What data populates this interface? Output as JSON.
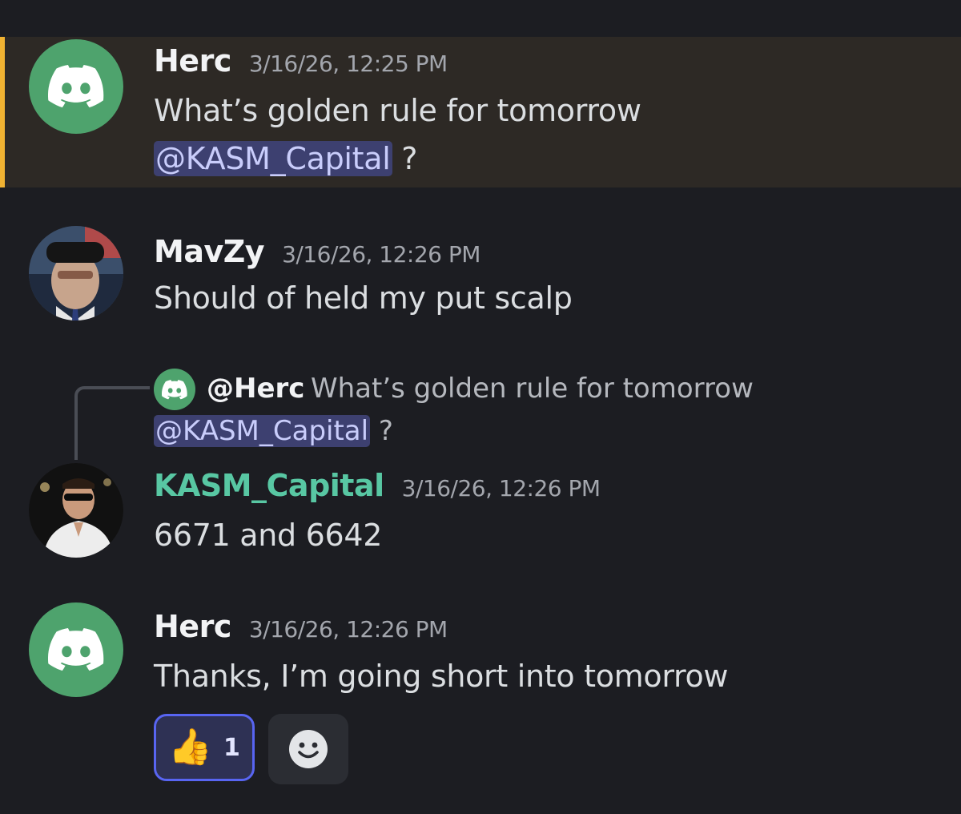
{
  "messages": [
    {
      "username": "Herc",
      "timestamp": "3/16/26, 12:25 PM",
      "line1": "What’s golden rule for tomorrow",
      "mention": "@KASM_Capital",
      "suffix": " ?",
      "avatar": "discord-logo-icon",
      "highlight_color": "#f0b232"
    },
    {
      "username": "MavZy",
      "timestamp": "3/16/26, 12:26 PM",
      "text": "Should of held my put scalp",
      "avatar": "user-photo"
    },
    {
      "reply": {
        "user": "@Herc",
        "line1": "What’s golden rule for tomorrow",
        "mention": "@KASM_Capital",
        "suffix": " ?"
      },
      "username": "KASM_Capital",
      "username_color": "#58c7a3",
      "timestamp": "3/16/26, 12:26 PM",
      "text": "6671 and 6642",
      "avatar": "user-photo"
    },
    {
      "username": "Herc",
      "timestamp": "3/16/26, 12:26 PM",
      "text": "Thanks, I’m going short into tomorrow",
      "avatar": "discord-logo-icon",
      "reactions": [
        {
          "emoji": "👍",
          "count": "1",
          "selected": true
        }
      ],
      "add_reaction_icon": "smiley-face-icon"
    }
  ],
  "colors": {
    "background": "#1c1d22",
    "highlight_bg": "#2d2925",
    "mention_bg": "#3d4070",
    "discord_green": "#4ea36d"
  }
}
